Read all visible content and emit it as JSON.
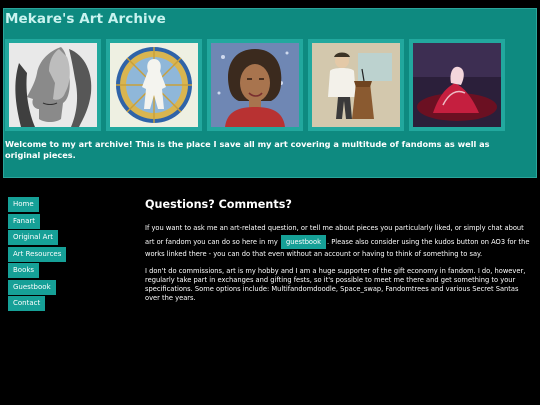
{
  "site": {
    "title": "Mekare's Art Archive",
    "welcome": "Welcome to my art archive! This is the place I save all my art covering a multitude of fandoms as well as original pieces."
  },
  "gallery": [
    {
      "name": "profile-portrait-artwork"
    },
    {
      "name": "stained-glass-figure-artwork"
    },
    {
      "name": "curly-hair-portrait-artwork"
    },
    {
      "name": "podium-speaker-artwork"
    },
    {
      "name": "red-figure-abstract-artwork"
    }
  ],
  "nav": {
    "items": [
      {
        "label": "Home"
      },
      {
        "label": "Fanart"
      },
      {
        "label": "Original Art"
      },
      {
        "label": "Art Resources"
      },
      {
        "label": "Books"
      },
      {
        "label": "Guestbook"
      },
      {
        "label": "Contact"
      }
    ]
  },
  "content": {
    "heading": "Questions? Comments?",
    "p1_before": "If you want to ask me an art-related question, or tell me about pieces you particularly liked, or simply chat about art or fandom you can do so here in my",
    "guestbook_button": "guestbook",
    "p1_after": ". Please also consider using the kudos button on AO3 for the works linked there - you can do that even without an account or having to think of something to say.",
    "p2": "I don't do commissions, art is my hobby and I am a huge supporter of the gift economy in fandom. I do, however, regularly take part in exchanges and gifting fests, so it's possible to meet me there and get something to your specifications. Some options include: Multifandomdoodle, Space_swap, Fandomtrees and various Secret Santas over the years."
  },
  "colors": {
    "header_bg": "#0e8a80",
    "accent": "#16a097",
    "title_text": "#c9f3ef",
    "page_bg": "#000000"
  }
}
